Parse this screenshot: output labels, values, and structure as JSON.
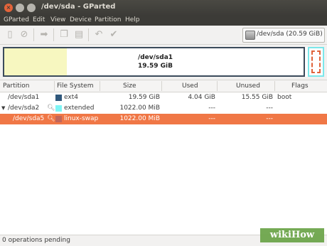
{
  "window": {
    "title": "/dev/sda - GParted"
  },
  "menu": [
    "GParted",
    "Edit",
    "View",
    "Device",
    "Partition",
    "Help"
  ],
  "device": {
    "label": "/dev/sda  (20.59 GiB)"
  },
  "graph": {
    "name": "/dev/sda1",
    "size": "19.59 GiB"
  },
  "table": {
    "headers": [
      "Partition",
      "File System",
      "Size",
      "Used",
      "Unused",
      "Flags"
    ],
    "rows": [
      {
        "partition": "/dev/sda1",
        "fs": "ext4",
        "size": "19.59 GiB",
        "used": "4.04 GiB",
        "unused": "15.55 GiB",
        "flags": "boot",
        "fs_color": "#30587c"
      },
      {
        "partition": "/dev/sda2",
        "fs": "extended",
        "size": "1022.00 MiB",
        "used": "---",
        "unused": "---",
        "flags": "",
        "fs_color": "#7ef5f5"
      },
      {
        "partition": "/dev/sda5",
        "fs": "linux-swap",
        "size": "1022.00 MiB",
        "used": "---",
        "unused": "---",
        "flags": "",
        "fs_color": "#c1665a"
      }
    ]
  },
  "status": {
    "text": "0 operations pending"
  },
  "watermark": "wikiHow"
}
